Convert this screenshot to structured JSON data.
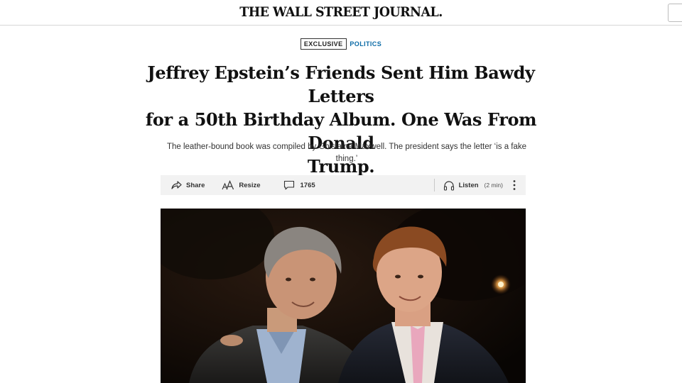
{
  "masthead": {
    "logo_text": "THE WALL STREET JOURNAL."
  },
  "article": {
    "flag_exclusive": "EXCLUSIVE",
    "flag_section": "POLITICS",
    "headline_line1": "Jeffrey Epstein’s Friends Sent Him Bawdy Letters",
    "headline_line2": "for a 50th Birthday Album. One Was From Donald",
    "headline_line3": "Trump.",
    "dek_line1": "The leather-bound book was compiled by Ghislaine Maxwell. The president says the letter ‘is a fake",
    "dek_line2": "thing.’"
  },
  "toolbar": {
    "share_label": "Share",
    "share_icon": "share-icon",
    "resize_label": "Resize",
    "resize_icon": "text-resize-icon",
    "comments_count": "1765",
    "comments_icon": "comment-icon",
    "listen_label": "Listen",
    "listen_duration": "(2 min)",
    "listen_icon": "headphones-icon",
    "more_icon": "more-vertical-icon"
  },
  "colors": {
    "section_flag": "#0a6aa6",
    "toolbar_bg": "#f2f2f2",
    "photo_bg": "#0b0704"
  }
}
